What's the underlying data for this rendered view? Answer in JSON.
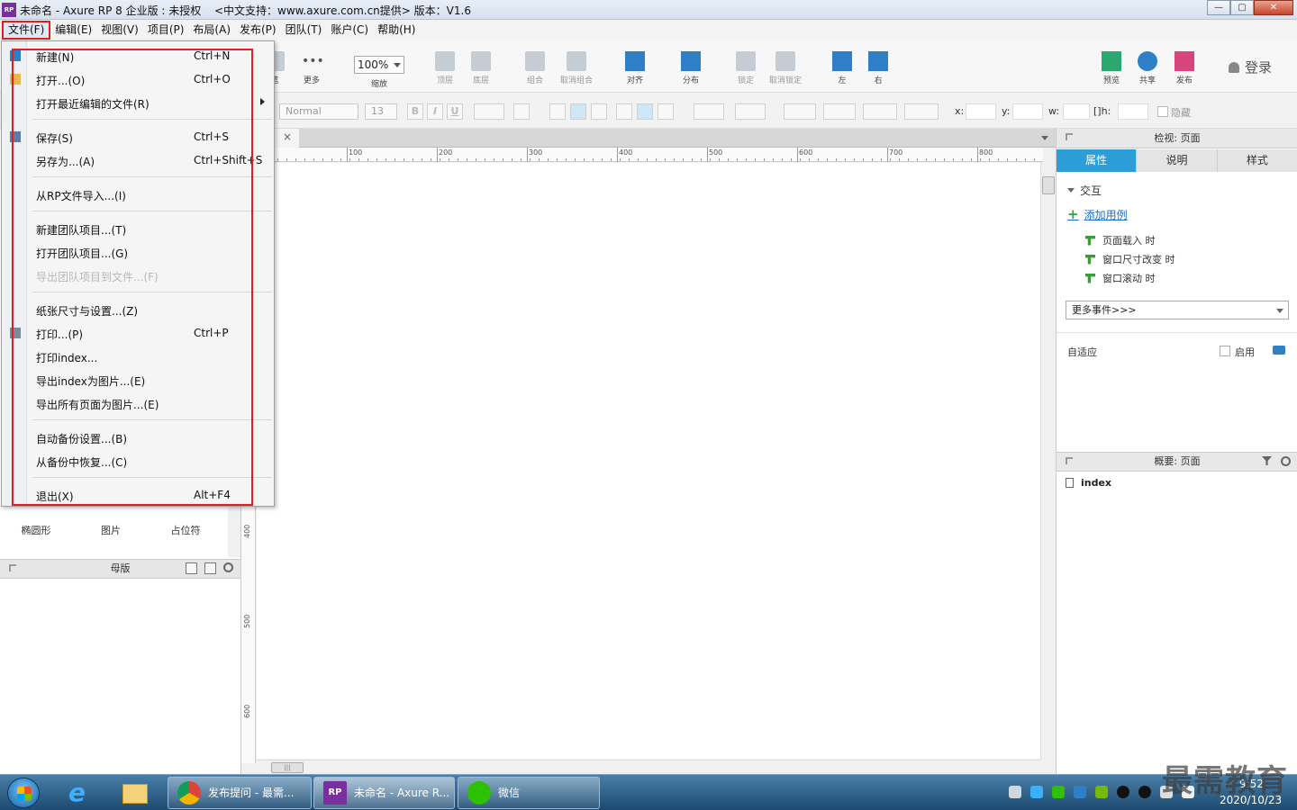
{
  "window": {
    "title": "未命名 - Axure RP 8 企业版 : 未授权",
    "title_extra": "<中文支持：www.axure.com.cn提供> 版本：V1.6",
    "logo": "RP"
  },
  "menubar": {
    "items": [
      "文件(F)",
      "编辑(E)",
      "视图(V)",
      "项目(P)",
      "布局(A)",
      "发布(P)",
      "团队(T)",
      "账户(C)",
      "帮助(H)"
    ]
  },
  "toolbar": {
    "buttons": {
      "pen": "笔",
      "more": "更多",
      "zoom_label": "缩放",
      "top": "顶层",
      "bottom": "底层",
      "group": "组合",
      "ungroup": "取消组合",
      "align": "对齐",
      "distribute": "分布",
      "lock": "锁定",
      "unlock": "取消锁定",
      "left": "左",
      "right": "右",
      "preview": "预览",
      "share": "共享",
      "publish": "发布"
    },
    "zoom_value": "100%",
    "login": "登录"
  },
  "formatbar": {
    "style_select": "Normal",
    "font_size": "13",
    "bold": "B",
    "italic": "I",
    "underline": "U",
    "x_label": "x:",
    "y_label": "y:",
    "w_label": "w:",
    "h_label": "h:",
    "hide_label": "隐藏"
  },
  "file_menu": {
    "items": [
      {
        "label": "新建(N)",
        "shortcut": "Ctrl+N"
      },
      {
        "label": "打开...(O)",
        "shortcut": "Ctrl+O"
      },
      {
        "label": "打开最近编辑的文件(R)",
        "shortcut": ""
      },
      {
        "label": "保存(S)",
        "shortcut": "Ctrl+S"
      },
      {
        "label": "另存为...(A)",
        "shortcut": "Ctrl+Shift+S"
      },
      {
        "label": "从RP文件导入...(I)",
        "shortcut": ""
      },
      {
        "label": "新建团队项目...(T)",
        "shortcut": ""
      },
      {
        "label": "打开团队项目...(G)",
        "shortcut": ""
      },
      {
        "label": "导出团队项目到文件...(F)",
        "shortcut": ""
      },
      {
        "label": "纸张尺寸与设置...(Z)",
        "shortcut": ""
      },
      {
        "label": "打印...(P)",
        "shortcut": "Ctrl+P"
      },
      {
        "label": "打印index...",
        "shortcut": ""
      },
      {
        "label": "导出index为图片...(E)",
        "shortcut": ""
      },
      {
        "label": "导出所有页面为图片...(E)",
        "shortcut": ""
      },
      {
        "label": "自动备份设置...(B)",
        "shortcut": ""
      },
      {
        "label": "从备份中恢复...(C)",
        "shortcut": ""
      },
      {
        "label": "退出(X)",
        "shortcut": "Alt+F4"
      }
    ]
  },
  "left_panel": {
    "library_items": [
      "椭圆形",
      "图片",
      "占位符"
    ],
    "masters_title": "母版"
  },
  "canvas": {
    "tab_close": "×",
    "ruler_top": [
      "100",
      "200",
      "300",
      "400",
      "500",
      "600",
      "700",
      "800"
    ],
    "ruler_left": [
      "400",
      "500",
      "600"
    ],
    "hscroll_thumb": "|||"
  },
  "right_panel": {
    "inspector_title": "检视: 页面",
    "tabs": [
      "属性",
      "说明",
      "样式"
    ],
    "interaction_title": "交互",
    "add_case": "添加用例",
    "events": [
      "页面载入 时",
      "窗口尺寸改变 时",
      "窗口滚动 时"
    ],
    "more_events": "更多事件>>>",
    "adaptive": "自适应",
    "enable": "启用",
    "overview_title": "概要: 页面",
    "pages": [
      "index"
    ]
  },
  "taskbar": {
    "tasks": [
      "发布提问 - 最需...",
      "未命名 - Axure R...",
      "微信"
    ],
    "date": "2020/10/23",
    "time": "9:52"
  },
  "watermark": "最需教育",
  "colors": {
    "accent": "#2b9ed8",
    "highlight": "#e02020",
    "link": "#1a6fc4"
  }
}
